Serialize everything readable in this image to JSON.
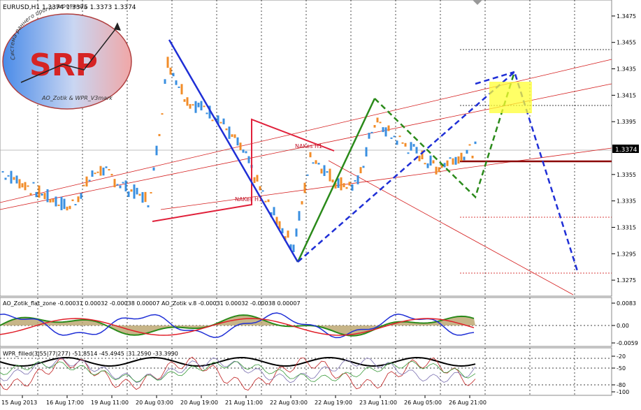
{
  "main": {
    "title": "EURUSD,H1  1.3374 1.3375 1.3373 1.3374",
    "current_price": "1.3374",
    "y_ticks": [
      "1.3475",
      "1.3455",
      "1.3435",
      "1.3415",
      "1.3395",
      "1.3374",
      "1.3355",
      "1.3335",
      "1.3315",
      "1.3295",
      "1.3275"
    ],
    "labels": [
      "NAKes H1",
      "NAKes H1"
    ],
    "logo": {
      "text": "SRP",
      "arc_text": "Система раннего прогнозирования",
      "sub_text": "AO_Zotik & WPR_V3mark"
    }
  },
  "ao_panel": {
    "title": "AO_Zotik_flat_zone -0.00031 0.00032 -0.00038 0.00007   AO_Zotik v.8 -0.00031 0.00032 -0.00038 0.00007",
    "y_ticks": [
      "0.0083",
      "0.00",
      "-0.0059"
    ]
  },
  "wpr_panel": {
    "title": "WPR_filled(3|55|77|277) -51.8514 -45.4945 -31.2590 -33.3990",
    "y_ticks": [
      "-20",
      "-50",
      "-80",
      "-100"
    ]
  },
  "x_axis": {
    "ticks": [
      "15 Aug 2013",
      "16 Aug 17:00",
      "19 Aug 11:00",
      "20 Aug 03:00",
      "20 Aug 19:00",
      "21 Aug 11:00",
      "22 Aug 03:00",
      "22 Aug 19:00",
      "23 Aug 11:00",
      "26 Aug 05:00",
      "26 Aug 21:00"
    ]
  },
  "colors": {
    "bull": "#3a8fe0",
    "bear": "#f28c28",
    "accent_blue": "#1f2fd6",
    "accent_green": "#2a8a1a",
    "accent_red": "#e0203a",
    "highlight": "#ffff33"
  },
  "chart_data": {
    "type": "candlestick",
    "price_range": [
      1.327,
      1.349
    ],
    "zigzag_blue": [
      [
        10,
        1.3451
      ],
      [
        25,
        1.3292
      ]
    ],
    "zigzag_green": [
      [
        25,
        1.3292
      ],
      [
        32,
        1.3404
      ]
    ],
    "green_retrace": [
      [
        32,
        1.3404
      ],
      [
        40,
        1.334
      ],
      [
        44,
        1.3431
      ]
    ],
    "forecast_blue_dashed": [
      [
        25,
        1.3292
      ],
      [
        44,
        1.3431
      ],
      [
        49,
        1.3283
      ]
    ],
    "support_level": 1.3366,
    "target_box": [
      1.3403,
      1.3425
    ]
  }
}
